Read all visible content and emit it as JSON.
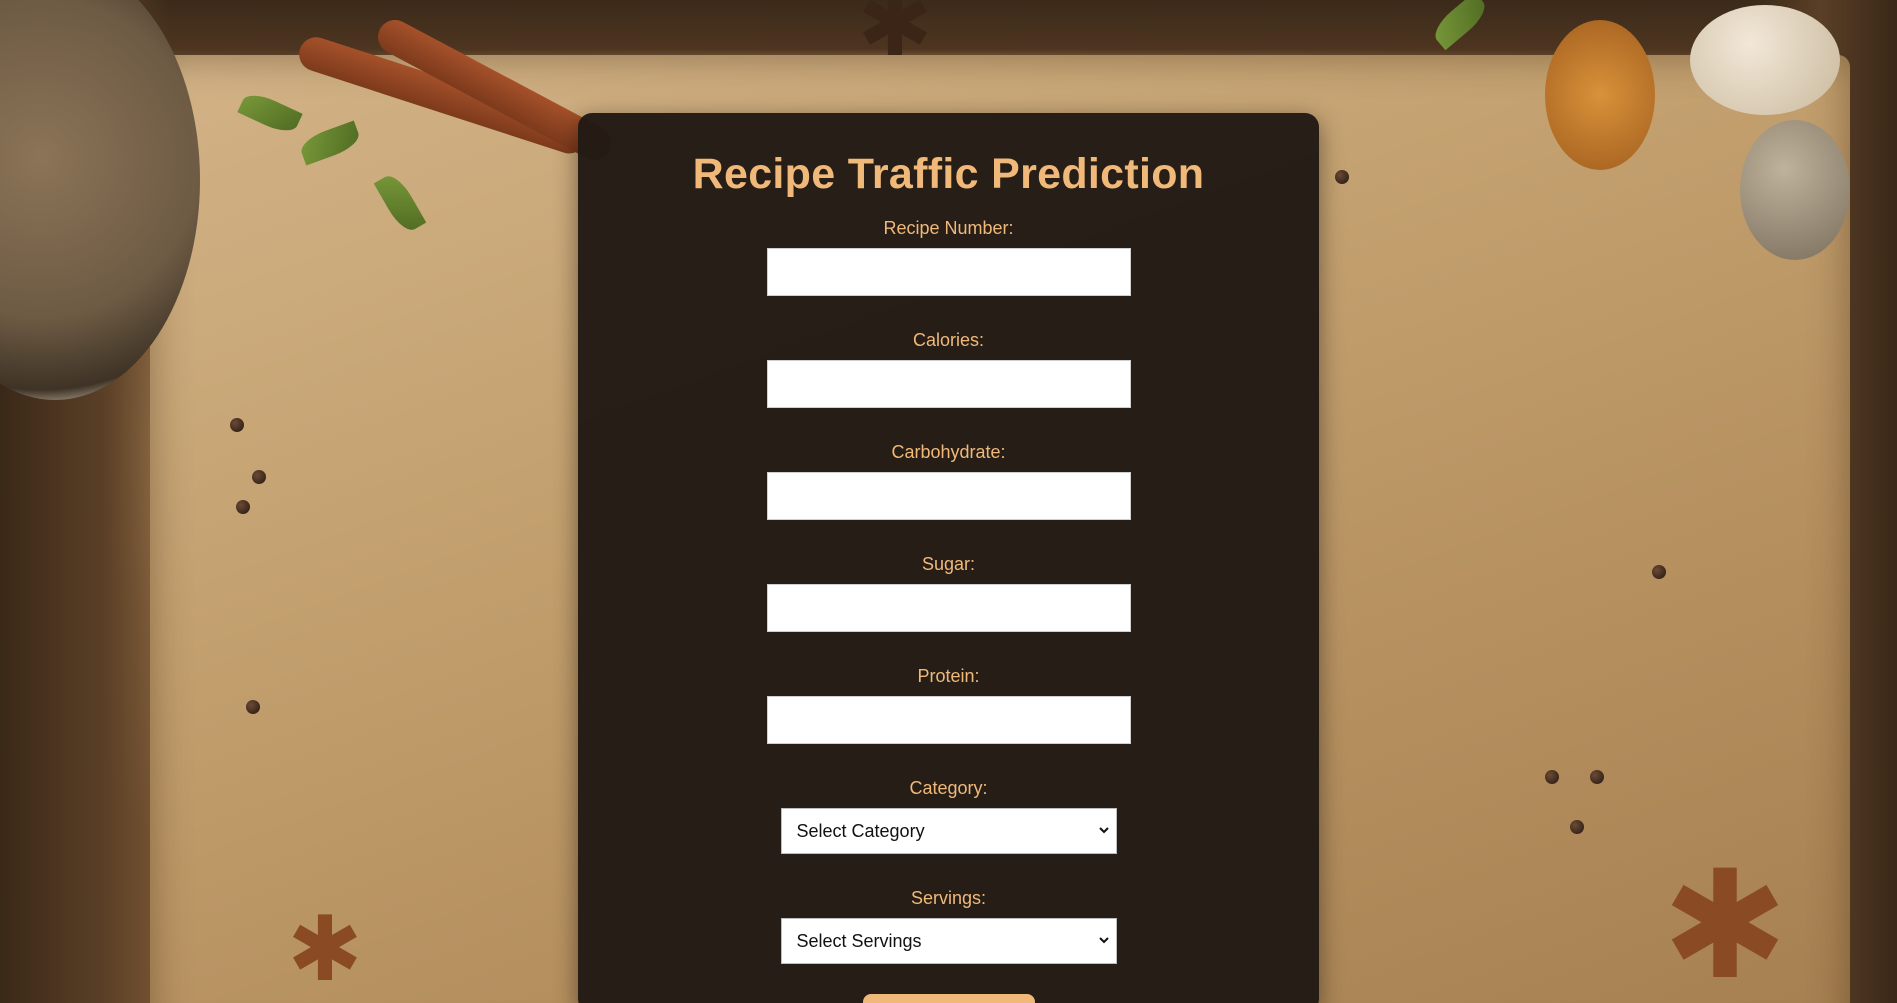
{
  "page": {
    "title": "Recipe Traffic Prediction"
  },
  "form": {
    "fields": [
      {
        "label": "Recipe Number:",
        "value": "",
        "placeholder": ""
      },
      {
        "label": "Calories:",
        "value": "",
        "placeholder": ""
      },
      {
        "label": "Carbohydrate:",
        "value": "",
        "placeholder": ""
      },
      {
        "label": "Sugar:",
        "value": "",
        "placeholder": ""
      },
      {
        "label": "Protein:",
        "value": "",
        "placeholder": ""
      }
    ],
    "category": {
      "label": "Category:",
      "selected": "Select Category"
    },
    "servings": {
      "label": "Servings:",
      "selected": "Select Servings"
    }
  },
  "theme": {
    "accent": "#f0b97a",
    "card_background": "#211a14"
  },
  "icons": {
    "select_arrow": "chevron-down-icon"
  }
}
